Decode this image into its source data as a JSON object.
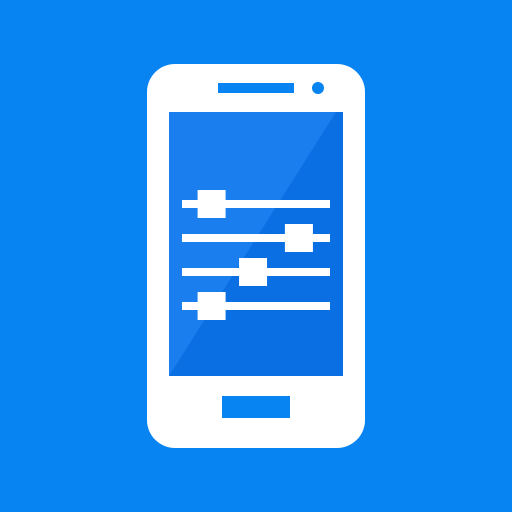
{
  "icon": {
    "name": "phone-equalizer-settings-icon",
    "glyph": "smartphone-with-sliders"
  },
  "colors": {
    "background": "#0784F2",
    "phone_body": "#FFFFFF",
    "screen": "#1B7EEF",
    "screen_shade": "#0B6FE4",
    "accent": "#0784F2"
  },
  "sliders": [
    {
      "name": "slider-1",
      "level": 0.2
    },
    {
      "name": "slider-2",
      "level": 0.79
    },
    {
      "name": "slider-3",
      "level": 0.48
    },
    {
      "name": "slider-4",
      "level": 0.2
    }
  ]
}
